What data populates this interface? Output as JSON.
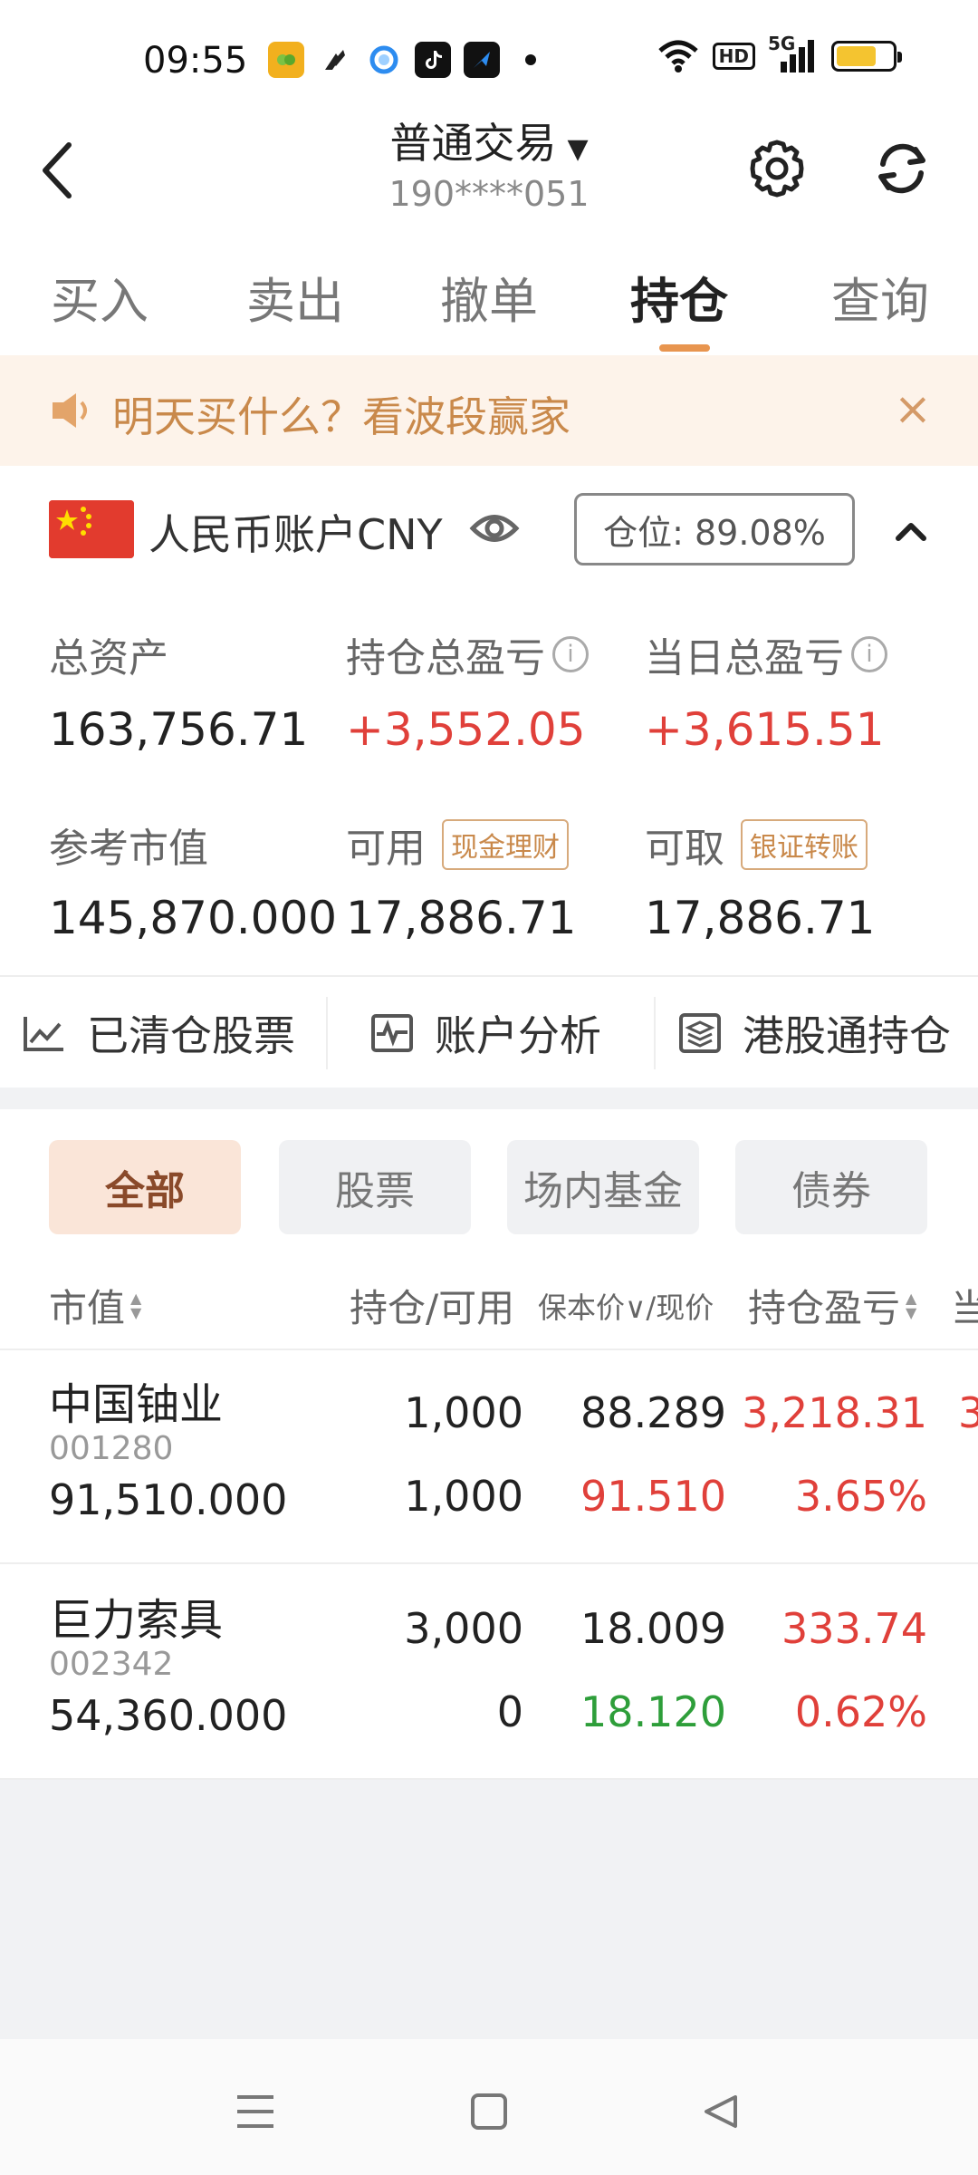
{
  "status_bar": {
    "time": "09:55",
    "signal_label": "5G",
    "hd_label": "HD",
    "icons": [
      "app-yellow-icon",
      "feather-icon",
      "cloud-icon",
      "tiktok-icon",
      "arrow-app-icon",
      "wifi-icon",
      "signal-icon",
      "battery-icon"
    ]
  },
  "header": {
    "title": "普通交易",
    "caret": "▼",
    "account_id": "190****051"
  },
  "tabs": [
    {
      "label": "买入"
    },
    {
      "label": "卖出"
    },
    {
      "label": "撤单"
    },
    {
      "label": "持仓",
      "active": true
    },
    {
      "label": "查询"
    }
  ],
  "notice": {
    "text": "明天买什么？看波段赢家",
    "close": "×"
  },
  "account": {
    "name": "人民币账户CNY",
    "position_label": "仓位: 89.08%"
  },
  "metrics": {
    "total_assets_label": "总资产",
    "total_assets": "163,756.71",
    "holding_pl_label": "持仓总盈亏",
    "holding_pl": "+3,552.05",
    "daily_pl_label": "当日总盈亏",
    "daily_pl": "+3,615.51",
    "market_value_label": "参考市值",
    "market_value": "145,870.000",
    "available_label": "可用",
    "available_tag": "现金理财",
    "available": "17,886.71",
    "withdrawable_label": "可取",
    "withdrawable_tag": "银证转账",
    "withdrawable": "17,886.71",
    "info_mark": "i"
  },
  "quick_actions": [
    {
      "label": "已清仓股票",
      "icon": "chart-icon"
    },
    {
      "label": "账户分析",
      "icon": "pulse-icon"
    },
    {
      "label": "港股通持仓",
      "icon": "layers-icon"
    }
  ],
  "filters": [
    {
      "label": "全部",
      "active": true
    },
    {
      "label": "股票"
    },
    {
      "label": "场内基金"
    },
    {
      "label": "债券"
    }
  ],
  "table": {
    "headers": {
      "market_value": "市值",
      "holding_available": "持仓/可用",
      "cost_price": "保本价∨/现价",
      "holding_pl": "持仓盈亏",
      "daily": "当"
    },
    "rows": [
      {
        "name": "中国铀业",
        "code": "001280",
        "market_value": "91,510.000",
        "holding": "1,000",
        "available": "1,000",
        "cost": "88.289",
        "price": "91.510",
        "pl": "3,218.31",
        "pl_pct": "3.65%",
        "daily_cut": "3"
      },
      {
        "name": "巨力索具",
        "code": "002342",
        "market_value": "54,360.000",
        "holding": "3,000",
        "available": "0",
        "cost": "18.009",
        "price": "18.120",
        "pl": "333.74",
        "pl_pct": "0.62%",
        "daily_cut": ""
      }
    ]
  },
  "colors": {
    "accent": "#e8954f",
    "up": "#e0403a",
    "down": "#2e9e3a",
    "notice_bg": "#fdf3ea"
  }
}
